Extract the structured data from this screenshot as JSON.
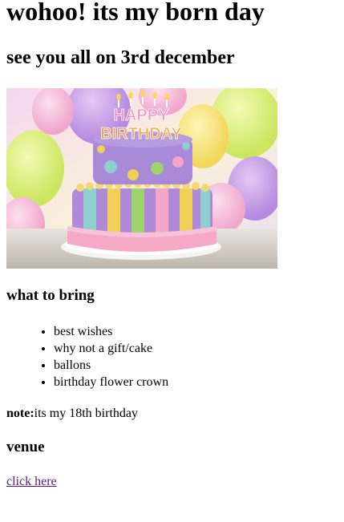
{
  "heading": "wohoo! its my born day",
  "subheading": "see you all on 3rd december",
  "image": {
    "banner_text_1": "HAPPY",
    "banner_text_2": "BIRTHDAY"
  },
  "bring": {
    "title": "what to bring",
    "items": [
      "best wishes",
      "why not a gift/cake",
      "ballons",
      "birthday flower crown"
    ]
  },
  "note": {
    "label": "note:",
    "text": "its my 18th birthday"
  },
  "venue": {
    "title": "venue",
    "link": "click here"
  },
  "colors": {
    "link_visited": "#551a8b"
  }
}
